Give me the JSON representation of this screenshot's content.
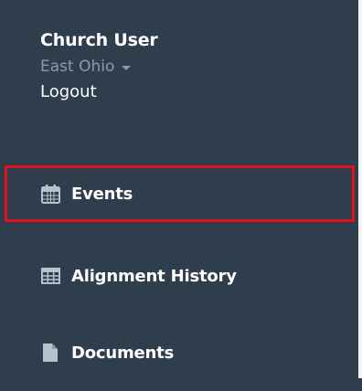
{
  "user": {
    "name": "Church User",
    "region": "East Ohio",
    "logout_label": "Logout"
  },
  "nav": {
    "items": [
      {
        "label": "Events",
        "icon": "calendar-icon",
        "highlighted": true
      },
      {
        "label": "Alignment History",
        "icon": "table-icon",
        "highlighted": false
      },
      {
        "label": "Documents",
        "icon": "document-icon",
        "highlighted": false
      }
    ]
  },
  "colors": {
    "sidebar_bg": "#2f3e4d",
    "highlight_border": "#e3111b",
    "muted_text": "#8d9aa7",
    "icon": "#b8c2cc"
  }
}
